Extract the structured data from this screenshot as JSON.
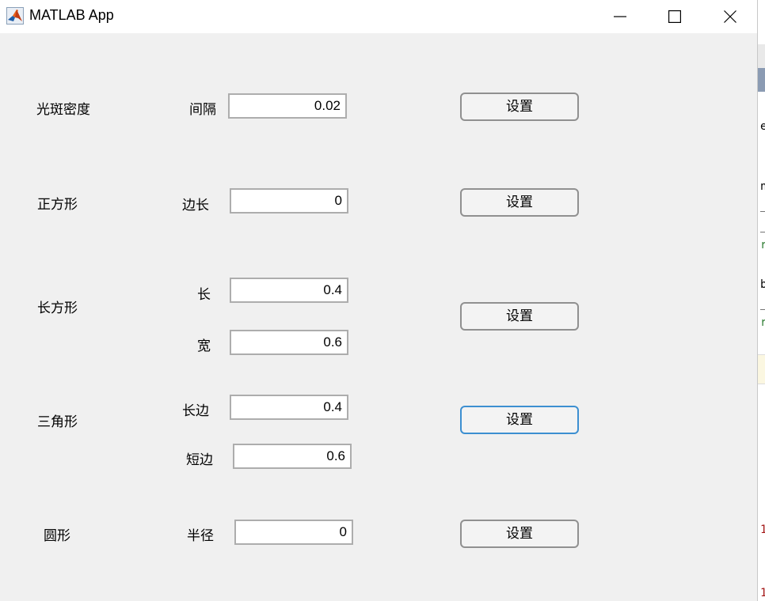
{
  "window": {
    "title": "MATLAB App"
  },
  "sections": {
    "density": {
      "label": "光斑密度",
      "fields": [
        {
          "label": "间隔",
          "value": "0.02"
        }
      ],
      "button": "设置"
    },
    "square": {
      "label": "正方形",
      "fields": [
        {
          "label": "边长",
          "value": "0"
        }
      ],
      "button": "设置"
    },
    "rectangle": {
      "label": "长方形",
      "fields": [
        {
          "label": "长",
          "value": "0.4"
        },
        {
          "label": "宽",
          "value": "0.6"
        }
      ],
      "button": "设置"
    },
    "triangle": {
      "label": "三角形",
      "fields": [
        {
          "label": "长边",
          "value": "0.4"
        },
        {
          "label": "短边",
          "value": "0.6"
        }
      ],
      "button": "设置"
    },
    "circle": {
      "label": "圆形",
      "fields": [
        {
          "label": "半径",
          "value": "0"
        }
      ],
      "button": "设置"
    }
  },
  "background_strip": {
    "glyphs": [
      "e",
      "n",
      "_",
      "_",
      "r",
      "b",
      "_",
      "r",
      "1",
      "1"
    ]
  },
  "colors": {
    "focus_border": "#3c8fd1",
    "window_bg": "#f0f0f0",
    "strip_green": "#2e7d32",
    "strip_red": "#a31515"
  },
  "icons": {
    "app": "matlab-logo-icon",
    "minimize": "minimize-icon",
    "maximize": "maximize-icon",
    "close": "close-icon"
  }
}
